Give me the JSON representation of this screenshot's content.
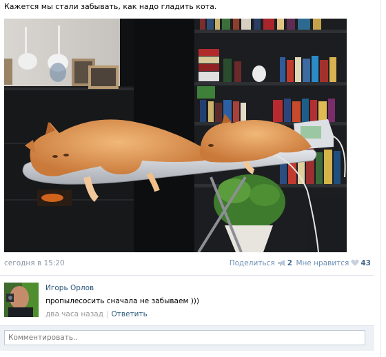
{
  "post": {
    "text": "Кажется мы стали забывать, как надо гладить кота.",
    "photo_alt": "cats-on-ironing-board",
    "date": "сегодня в 15:20",
    "share_label": "Поделиться",
    "share_count": "2",
    "like_label": "Мне нравится",
    "like_count": "43"
  },
  "comment": {
    "author": "Игорь Орлов",
    "text": "пропылесосить сначала не забываем )))",
    "time": "два часа назад",
    "separator": "|",
    "reply_label": "Ответить"
  },
  "comment_box": {
    "placeholder": "Комментировать.."
  },
  "colors": {
    "link": "#2b587a",
    "meta": "#8a96a4",
    "count": "#45688e",
    "comment_bar": "#edf1f5"
  },
  "icons": {
    "share": "megaphone-icon",
    "like": "heart-icon"
  }
}
